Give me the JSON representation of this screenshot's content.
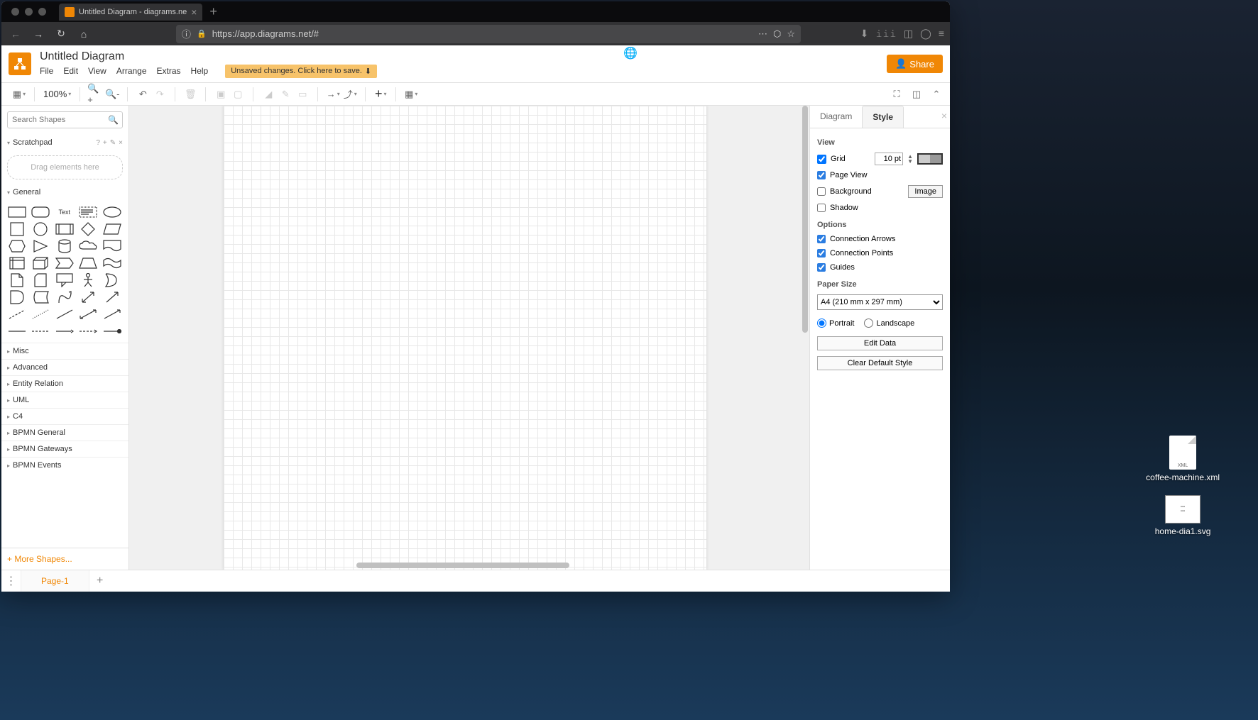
{
  "browser": {
    "tab_title": "Untitled Diagram - diagrams.ne",
    "url": "https://app.diagrams.net/#"
  },
  "app": {
    "doc_title": "Untitled Diagram",
    "menus": [
      "File",
      "Edit",
      "View",
      "Arrange",
      "Extras",
      "Help"
    ],
    "unsaved_notice": "Unsaved changes. Click here to save.",
    "share_label": "Share"
  },
  "toolbar": {
    "zoom": "100%"
  },
  "sidebar": {
    "search_placeholder": "Search Shapes",
    "scratchpad_label": "Scratchpad",
    "scratchpad_drop": "Drag elements here",
    "general_label": "General",
    "text_shape_label": "Text",
    "collapsed_sections": [
      "Misc",
      "Advanced",
      "Entity Relation",
      "UML",
      "C4",
      "BPMN General",
      "BPMN Gateways",
      "BPMN Events"
    ],
    "more_shapes": "+ More Shapes..."
  },
  "right_panel": {
    "tab_diagram": "Diagram",
    "tab_style": "Style",
    "view_heading": "View",
    "grid_label": "Grid",
    "grid_size": "10 pt",
    "page_view_label": "Page View",
    "background_label": "Background",
    "image_btn": "Image",
    "shadow_label": "Shadow",
    "options_heading": "Options",
    "conn_arrows_label": "Connection Arrows",
    "conn_points_label": "Connection Points",
    "guides_label": "Guides",
    "paper_heading": "Paper Size",
    "paper_value": "A4 (210 mm x 297 mm)",
    "portrait_label": "Portrait",
    "landscape_label": "Landscape",
    "edit_data_btn": "Edit Data",
    "clear_style_btn": "Clear Default Style"
  },
  "bottom": {
    "page_label": "Page-1"
  },
  "desktop": {
    "file1": "coffee-machine.xml",
    "file2": "home-dia1.svg"
  }
}
